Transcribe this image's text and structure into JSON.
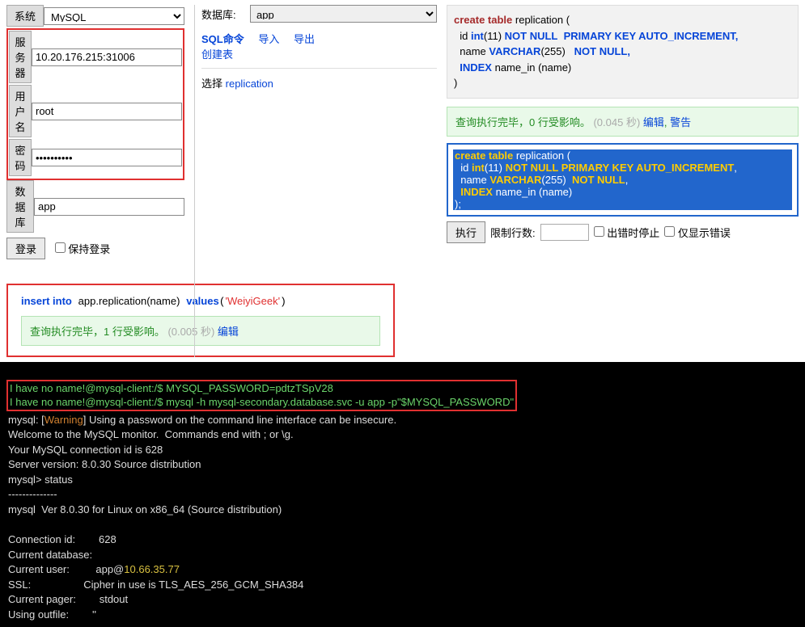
{
  "login": {
    "system_label": "系统",
    "system_value": "MySQL",
    "server_label": "服务器",
    "server_value": "10.20.176.215:31006",
    "user_label": "用户名",
    "user_value": "root",
    "password_label": "密码",
    "password_value": "••••••••••",
    "db_label": "数据库",
    "db_value": "app",
    "login_btn": "登录",
    "keep_login": "保持登录"
  },
  "nav": {
    "db_label": "数据库:",
    "db_selected": "app",
    "sql_cmd": "SQL命令",
    "import": "导入",
    "export": "导出",
    "create_table": "创建表",
    "select_prefix": "选择",
    "select_table": "replication"
  },
  "insert": {
    "sql_insert": "insert into",
    "tbl": "app.replication",
    "col": "(name)",
    "values_kw": "values",
    "value": "'WeiyiGeek'",
    "result_ok": "查询执行完毕，1 行受影响。",
    "secs": "(0.005 秒)",
    "edit": "编辑"
  },
  "create": {
    "l1a": "create table",
    "l1b": "replication (",
    "l2a": "id",
    "l2b": "int",
    "l2c": "(11)",
    "l2d": "NOT NULL",
    "l2e": "PRIMARY KEY AUTO_INCREMENT,",
    "l3a": "name",
    "l3b": "VARCHAR",
    "l3c": "(255)",
    "l3d": "NOT NULL,",
    "l4a": "INDEX",
    "l4b": "name_in (name)",
    "l5": ")",
    "result_ok": "查询执行完毕，0 行受影响。",
    "secs": "(0.045 秒)",
    "edit": "编辑",
    "warn": "警告"
  },
  "edit": {
    "l1": "create table replication (",
    "l2": "  id int(11) NOT NULL  PRIMARY KEY AUTO_INCREMENT,",
    "l3": "  name VARCHAR(255)  NOT NULL,",
    "l4": "  INDEX name_in (name)",
    "l5": ");",
    "execute": "执行",
    "limit_label": "限制行数:",
    "stop_on_err": "出错时停止",
    "only_errors": "仅显示错误"
  },
  "term": {
    "p1": "I have no name!@mysql-client:/$ MYSQL_PASSWORD=pdtzTSpV28",
    "p2": "I have no name!@mysql-client:/$ mysql -h mysql-secondary.database.svc -u app -p\"$MYSQL_PASSWORD\"",
    "t1a": "mysql: [",
    "t1b": "Warning",
    "t1c": "] Using a password on the command line interface can be insecure.",
    "t2": "Welcome to the MySQL monitor.  Commands end with ; or \\g.",
    "t3": "Your MySQL connection id is 628",
    "t4": "Server version: 8.0.30 Source distribution",
    "t5": "mysql> status",
    "t6": "--------------",
    "t7": "mysql  Ver 8.0.30 for Linux on x86_64 (Source distribution)",
    "t8": "",
    "t9": "Connection id:        628",
    "t10": "Current database:",
    "t11a": "Current user:         app@",
    "t11b": "10.66.35.77",
    "t12": "SSL:                  Cipher in use is TLS_AES_256_GCM_SHA384",
    "t13": "Current pager:        stdout",
    "t14": "Using outfile:        ''"
  }
}
